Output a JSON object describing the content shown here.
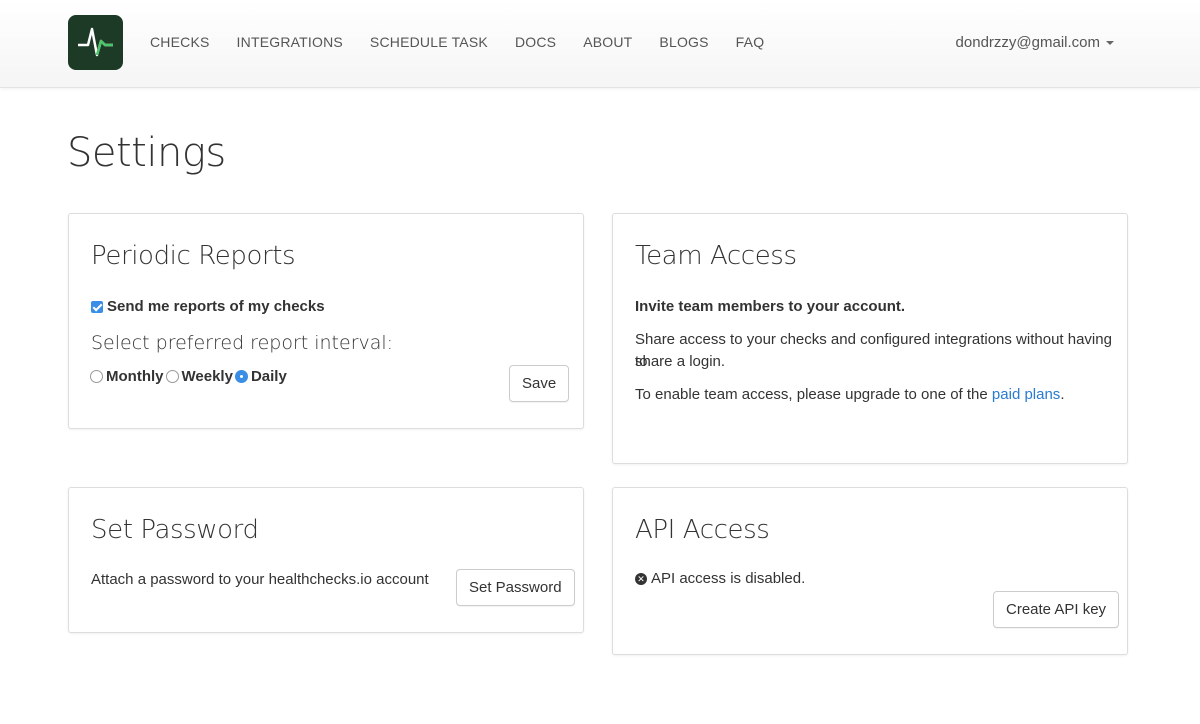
{
  "nav": {
    "logo_icon": "pulse-logo-icon",
    "links": [
      "CHECKS",
      "INTEGRATIONS",
      "SCHEDULE TASK",
      "DOCS",
      "ABOUT",
      "BLOGS",
      "FAQ"
    ],
    "user_email": "dondrzzy@gmail.com"
  },
  "page": {
    "title": "Settings"
  },
  "reports": {
    "title": "Periodic Reports",
    "checkbox_label": "Send me reports of my checks",
    "checkbox_checked": true,
    "interval_label": "Select preferred report interval:",
    "options": [
      "Monthly",
      "Weekly",
      "Daily"
    ],
    "selected": "Daily",
    "save_label": "Save"
  },
  "team": {
    "title": "Team Access",
    "invite": "Invite team members to your account.",
    "share_line1": "Share access to your checks and configured integrations without having to",
    "share_line2": "share a login.",
    "enable_prefix": "To enable team access, please upgrade to one of the ",
    "enable_link": "paid plans",
    "enable_suffix": "."
  },
  "password": {
    "title": "Set Password",
    "description": "Attach a password to your healthchecks.io account",
    "button_label": "Set Password"
  },
  "api": {
    "title": "API Access",
    "status": "API access is disabled.",
    "status_icon": "x-circle-icon",
    "button_label": "Create API key"
  },
  "colors": {
    "accent": "#3a8ee6",
    "link": "#2a7bd0",
    "logo_bg": "#1c3a25",
    "logo_pulse": "#4cc46a"
  }
}
